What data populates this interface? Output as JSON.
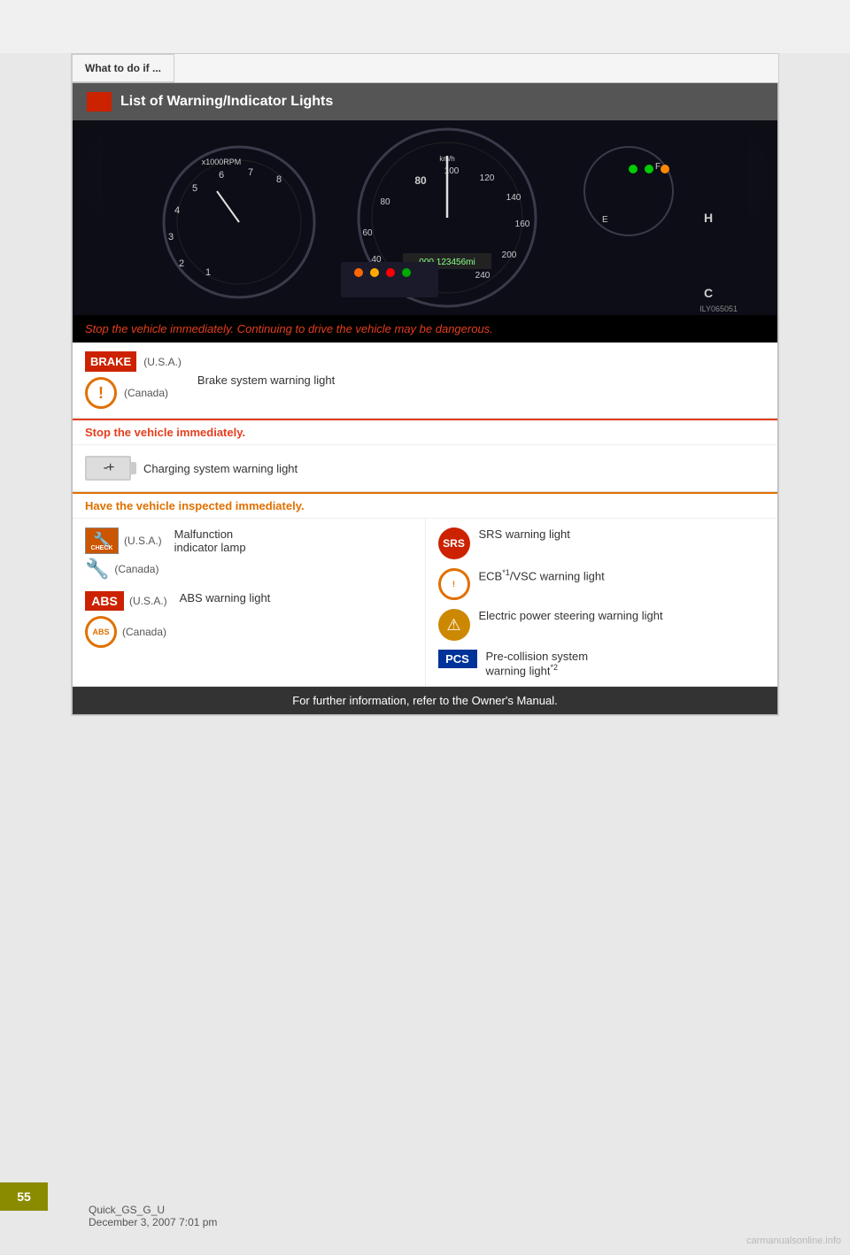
{
  "page": {
    "section_header": "What to do if ...",
    "title": "List of Warning/Indicator Lights",
    "page_number": "55",
    "file_label": "Quick_GS_G_U",
    "date_label": "December 3, 2007 7:01 pm",
    "watermark": "carmanualsonline.info",
    "image_label": "ILY065051"
  },
  "banners": {
    "danger": "Stop the vehicle immediately. Continuing to drive the vehicle may be dangerous.",
    "stop_immediately": "Stop the vehicle immediately.",
    "have_inspected": "Have the vehicle inspected immediately.",
    "footer": "For further information, refer to the Owner's Manual."
  },
  "brake_section": {
    "icon_text": "BRAKE",
    "usa_label": "(U.S.A.)",
    "canada_label": "(Canada)",
    "description": "Brake system warning light"
  },
  "charging_section": {
    "description": "Charging system warning light"
  },
  "left_warnings": [
    {
      "id": "malfunction",
      "icon_type": "check",
      "usa_label": "(U.S.A.)",
      "canada_label": "(Canada)",
      "description": "Malfunction\nindicator lamp"
    },
    {
      "id": "abs",
      "icon_type": "abs",
      "usa_label": "(U.S.A.)",
      "canada_label": "(Canada)",
      "description": "ABS warning light"
    }
  ],
  "right_warnings": [
    {
      "id": "srs",
      "icon_type": "srs",
      "description": "SRS warning light"
    },
    {
      "id": "ecb",
      "icon_type": "ecb",
      "description": "ECB*1/VSC warning light"
    },
    {
      "id": "eps",
      "icon_type": "eps",
      "description": "Electric power steering\nwarning light"
    },
    {
      "id": "pcs",
      "icon_type": "pcs",
      "icon_text": "PCS",
      "description": "Pre-collision system\nwarning light*2"
    }
  ]
}
